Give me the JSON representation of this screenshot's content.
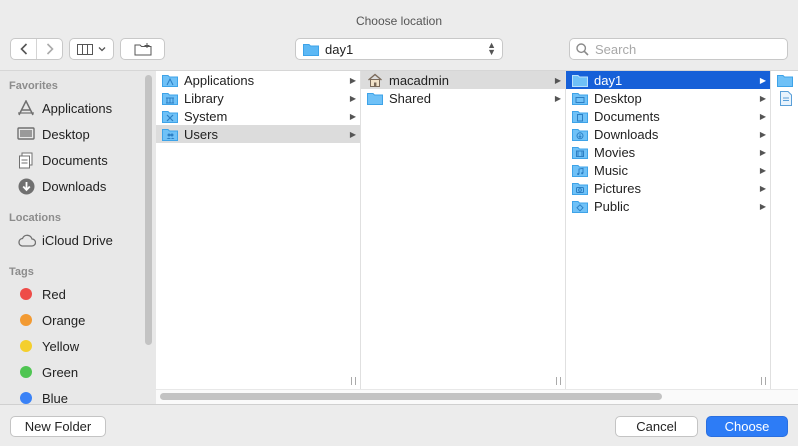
{
  "window": {
    "title": "Choose location"
  },
  "toolbar": {
    "location": "day1",
    "search_placeholder": "Search"
  },
  "sidebar": {
    "favorites_header": "Favorites",
    "favorites": [
      {
        "label": "Applications",
        "icon": "applications-icon"
      },
      {
        "label": "Desktop",
        "icon": "desktop-icon"
      },
      {
        "label": "Documents",
        "icon": "documents-icon"
      },
      {
        "label": "Downloads",
        "icon": "downloads-icon"
      }
    ],
    "locations_header": "Locations",
    "locations": [
      {
        "label": "iCloud Drive",
        "icon": "cloud-icon"
      }
    ],
    "tags_header": "Tags",
    "tags": [
      {
        "label": "Red",
        "color": "#ee4c48"
      },
      {
        "label": "Orange",
        "color": "#f29a32"
      },
      {
        "label": "Yellow",
        "color": "#f4cf2d"
      },
      {
        "label": "Green",
        "color": "#4fc552"
      },
      {
        "label": "Blue",
        "color": "#3a82f6"
      }
    ]
  },
  "columns": [
    {
      "items": [
        {
          "label": "Applications",
          "icon": "applications-folder-icon",
          "selected": false
        },
        {
          "label": "Library",
          "icon": "library-folder-icon",
          "selected": false
        },
        {
          "label": "System",
          "icon": "system-folder-icon",
          "selected": false
        },
        {
          "label": "Users",
          "icon": "users-folder-icon",
          "selected": "gray"
        }
      ]
    },
    {
      "items": [
        {
          "label": "macadmin",
          "icon": "home-icon",
          "selected": "gray"
        },
        {
          "label": "Shared",
          "icon": "folder-icon",
          "selected": false
        }
      ]
    },
    {
      "items": [
        {
          "label": "day1",
          "icon": "folder-icon",
          "selected": "blue"
        },
        {
          "label": "Desktop",
          "icon": "desktop-folder-icon",
          "selected": false
        },
        {
          "label": "Documents",
          "icon": "documents-folder-icon",
          "selected": false
        },
        {
          "label": "Downloads",
          "icon": "downloads-folder-icon",
          "selected": false
        },
        {
          "label": "Movies",
          "icon": "movies-folder-icon",
          "selected": false
        },
        {
          "label": "Music",
          "icon": "music-folder-icon",
          "selected": false
        },
        {
          "label": "Pictures",
          "icon": "pictures-folder-icon",
          "selected": false
        },
        {
          "label": "Public",
          "icon": "public-folder-icon",
          "selected": false
        }
      ]
    }
  ],
  "buttons": {
    "new_folder": "New Folder",
    "cancel": "Cancel",
    "choose": "Choose"
  }
}
